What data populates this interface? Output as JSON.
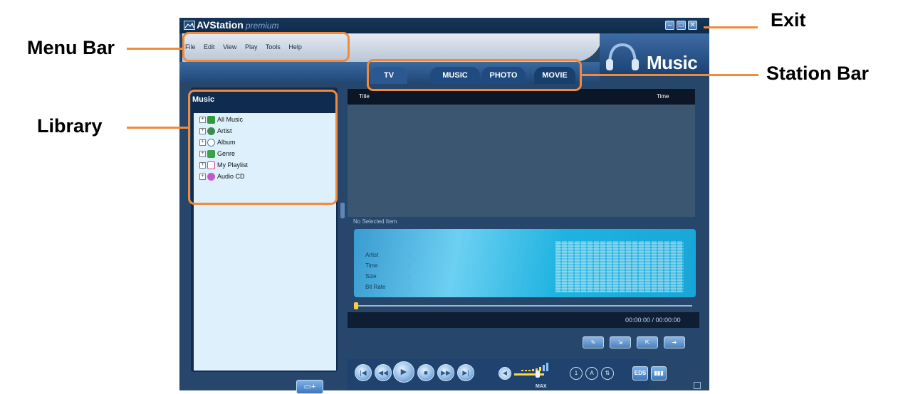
{
  "window": {
    "app_name": "AVStation",
    "app_edition": "premium",
    "buttons": {
      "minimize": "–",
      "maximize": "□",
      "close": "✕"
    }
  },
  "menu": [
    "File",
    "Edit",
    "View",
    "Play",
    "Tools",
    "Help"
  ],
  "station": {
    "current": "Music",
    "tabs": [
      "TV",
      "MUSIC",
      "PHOTO",
      "MOVIE"
    ]
  },
  "library": {
    "title": "Music",
    "items": [
      {
        "label": "All Music",
        "icon": "music-note-icon"
      },
      {
        "label": "Artist",
        "icon": "person-icon"
      },
      {
        "label": "Album",
        "icon": "disc-icon"
      },
      {
        "label": "Genre",
        "icon": "genre-icon"
      },
      {
        "label": "My Playlist",
        "icon": "playlist-icon"
      },
      {
        "label": "Audio CD",
        "icon": "cd-icon"
      }
    ],
    "new_button": "+"
  },
  "playlist": {
    "columns": {
      "title": "Title",
      "time": "Time"
    },
    "status": "No Selected Item"
  },
  "info": {
    "fields": [
      "Artist",
      "Time",
      "Size",
      "Bit Rate"
    ]
  },
  "player": {
    "time": "00:00:00 / 00:00:00",
    "volume_max_label": "MAX",
    "progress": 0,
    "volume_level": 0.7,
    "eds_label": "EDS",
    "transport": {
      "prev": "|◀",
      "rewind": "◀◀",
      "play": "▶",
      "stop": "■",
      "forward": "▶▶",
      "next": "▶|"
    }
  },
  "annotations": {
    "menu_bar": "Menu Bar",
    "library": "Library",
    "exit": "Exit",
    "station_bar": "Station Bar"
  },
  "colors": {
    "accent": "#f28a3a",
    "window": "#27466b",
    "library_bg": "#ddf0fb"
  }
}
